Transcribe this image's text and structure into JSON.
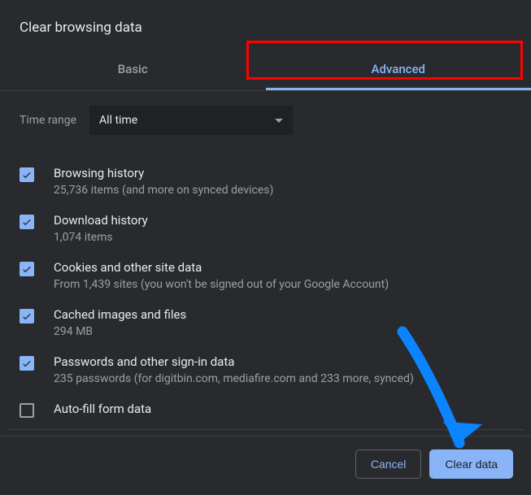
{
  "dialog": {
    "title": "Clear browsing data"
  },
  "tabs": {
    "basic": "Basic",
    "advanced": "Advanced"
  },
  "time": {
    "label": "Time range",
    "value": "All time"
  },
  "items": [
    {
      "title": "Browsing history",
      "desc": "25,736 items (and more on synced devices)",
      "checked": true
    },
    {
      "title": "Download history",
      "desc": "1,074 items",
      "checked": true
    },
    {
      "title": "Cookies and other site data",
      "desc": "From 1,439 sites (you won't be signed out of your Google Account)",
      "checked": true
    },
    {
      "title": "Cached images and files",
      "desc": "294 MB",
      "checked": true
    },
    {
      "title": "Passwords and other sign-in data",
      "desc": "235 passwords (for digitbin.com, mediafire.com and 233 more, synced)",
      "checked": true
    },
    {
      "title": "Auto-fill form data",
      "desc": "",
      "checked": false
    }
  ],
  "buttons": {
    "cancel": "Cancel",
    "clear": "Clear data"
  }
}
